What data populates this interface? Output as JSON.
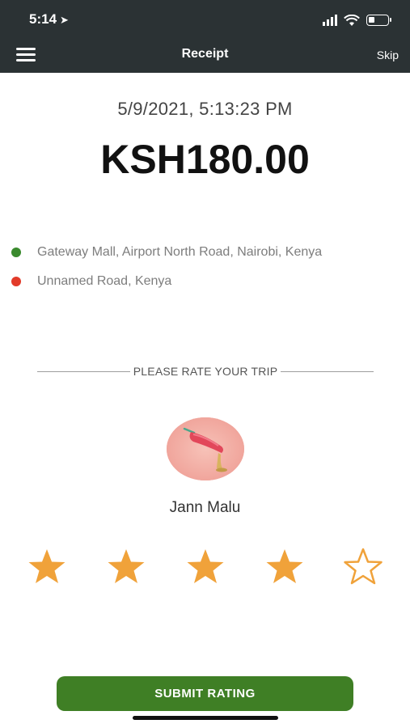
{
  "status_bar": {
    "time": "5:14"
  },
  "header": {
    "title": "Receipt",
    "skip_label": "Skip"
  },
  "receipt": {
    "datetime": "5/9/2021, 5:13:23 PM",
    "amount": "KSH180.00"
  },
  "route": {
    "pickup": {
      "address": "Gateway Mall, Airport North Road, Nairobi, Kenya",
      "dot_color": "#3a8a2e"
    },
    "dropoff": {
      "address": "Unnamed Road, Kenya",
      "dot_color": "#e23b2a"
    }
  },
  "rating": {
    "heading": "PLEASE RATE YOUR TRIP",
    "driver_name": "Jann Malu",
    "stars_selected": 4,
    "stars_total": 5,
    "star_color": "#f0a23a"
  },
  "submit_label": "SUBMIT RATING",
  "colors": {
    "header_bg": "#2b3234",
    "button_bg": "#3f7f25"
  }
}
